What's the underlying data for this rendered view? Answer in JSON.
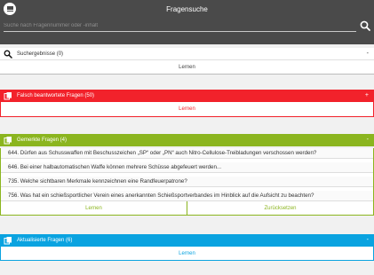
{
  "app": {
    "title": "Fragensuche",
    "search_placeholder": "Suche nach Fragennummer oder -inhalt",
    "icons": {
      "menu": "hamburger-icon",
      "search": "search-icon"
    }
  },
  "sections": {
    "search_results": {
      "title": "Suchergebnisse (0)",
      "toggle": "-",
      "action": "Lernen",
      "icon": "search-icon"
    },
    "wrong_answers": {
      "title": "Falsch beantwortete Fragen (50)",
      "toggle": "+",
      "action": "Lernen",
      "color": "#f2222b",
      "icon": "cards-icon"
    },
    "marked": {
      "title": "Gemerkte Fragen (4)",
      "toggle": "-",
      "color": "#8bb51f",
      "icon": "cards-icon",
      "items": [
        "644. Dürfen aus Schusswaffen mit Beschusszeichen „SP“ oder „PN“ auch Nitro-Cellulose-Treibladungen verschossen werden?",
        "646. Bei einer halbautomatischen Waffe können mehrere Schüsse abgefeuert werden...",
        "735. Welche sichtbaren Merkmale kennzeichnen eine Randfeuerpatrone?",
        "756. Was hat ein schießsportlicher Verein eines anerkannten Schießsportverbandes im Hinblick auf die Aufsicht zu beachten?"
      ],
      "action_learn": "Lernen",
      "action_reset": "Zurücksetzen"
    },
    "updated": {
      "title": "Aktualisierte Fragen (6)",
      "toggle": "-",
      "action": "Lernen",
      "color": "#0aa3e0",
      "icon": "cards-icon"
    }
  }
}
